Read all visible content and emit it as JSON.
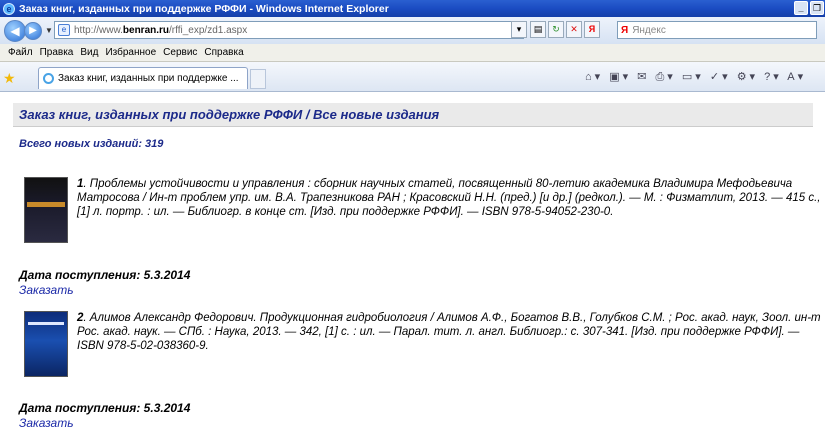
{
  "window": {
    "title": "Заказ книг, изданных при поддержке РФФИ - Windows Internet Explorer",
    "minimize_label": "_",
    "restore_label": "❐"
  },
  "address": {
    "url_prefix": "http://www.",
    "url_domain": "benran.ru",
    "url_path": "/rffi_exp/zd1.aspx",
    "search_placeholder": "Яндекс",
    "search_brand": "Я"
  },
  "menu": [
    "Файл",
    "Правка",
    "Вид",
    "Избранное",
    "Сервис",
    "Справка"
  ],
  "tab": {
    "title": "Заказ книг, изданных при поддержке ..."
  },
  "page": {
    "header": "Заказ книг, изданных при поддержке РФФИ / Все новые издания",
    "total": "Всего новых изданий: 319"
  },
  "books": [
    {
      "number": "1",
      "description": ". Проблемы устойчивости и управления : сборник научных статей, посвященный 80-летию академика Владимира Мефодьевича Матросова / Ин-т проблем упр. им. В.А. Трапезникова РАН ; Красовский Н.Н. (пред.) [и др.] (редкол.). — М. : Физматлит, 2013. — 415 с., [1] л. портр. : ил. — Библиогр. в конце ст. [Изд. при поддержке РФФИ]. — ISBN 978-5-94052-230-0.",
      "received": "Дата поступления: 5.3.2014",
      "order_label": "Заказать"
    },
    {
      "number": "2",
      "description": ". Алимов Александр Федорович. Продукционная гидробиология / Алимов А.Ф., Богатов В.В., Голубков С.М. ; Рос. акад. наук, Зоол. ин-т Рос. акад. наук. — СПб. : Наука, 2013. — 342, [1] с. : ил. — Парал. тит. л. англ. Библиогр.: с. 307-341. [Изд. при поддержке РФФИ]. — ISBN 978-5-02-038360-9.",
      "received": "Дата поступления: 5.3.2014",
      "order_label": "Заказать"
    }
  ]
}
